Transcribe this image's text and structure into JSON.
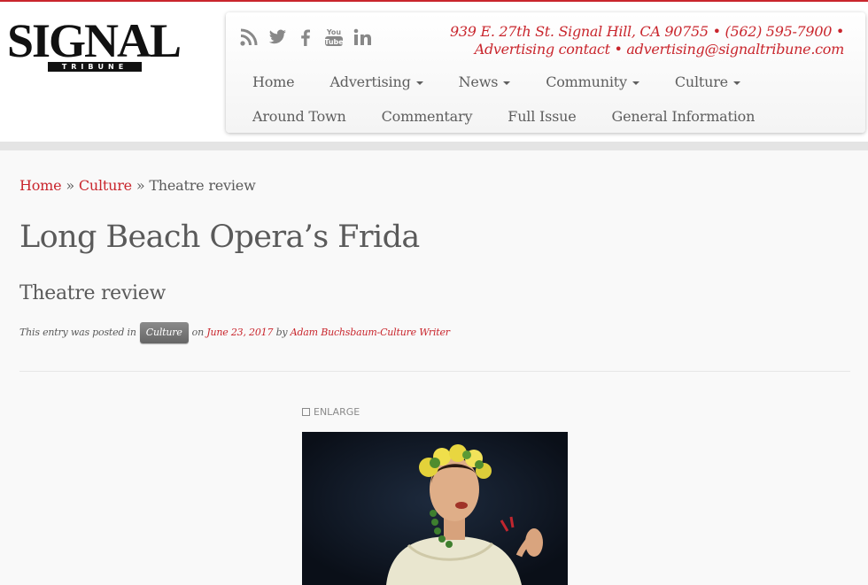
{
  "logo": {
    "word": "SIGNAL",
    "subword": "TRIBUNE"
  },
  "social": [
    "rss-icon",
    "twitter-icon",
    "facebook-icon",
    "youtube-icon",
    "linkedin-icon"
  ],
  "contact": {
    "line1": "939 E. 27th St. Signal Hill, CA 90755 • (562) 595-7900 •",
    "line2": "Advertising contact • advertising@signaltribune.com"
  },
  "nav": {
    "row1": [
      {
        "label": "Home",
        "dropdown": false
      },
      {
        "label": "Advertising",
        "dropdown": true
      },
      {
        "label": "News",
        "dropdown": true
      },
      {
        "label": "Community",
        "dropdown": true
      },
      {
        "label": "Culture",
        "dropdown": true
      }
    ],
    "row2": [
      {
        "label": "Around Town"
      },
      {
        "label": "Commentary"
      },
      {
        "label": "Full Issue"
      },
      {
        "label": "General Information"
      }
    ]
  },
  "breadcrumb": {
    "home": "Home",
    "sep": "»",
    "section": "Culture",
    "current": "Theatre review"
  },
  "article": {
    "title": "Long Beach Opera’s Frida",
    "subtitle": "Theatre review",
    "meta": {
      "posted_in": "This entry was posted in",
      "category": "Culture",
      "on": "on",
      "date": "June 23, 2017",
      "by": "by",
      "author": "Adam Buchsbaum-Culture Writer"
    },
    "enlarge_label": "ENLARGE"
  },
  "colors": {
    "accent": "#c9262d",
    "text": "#5a5a5a",
    "background": "#f9f9f9"
  }
}
